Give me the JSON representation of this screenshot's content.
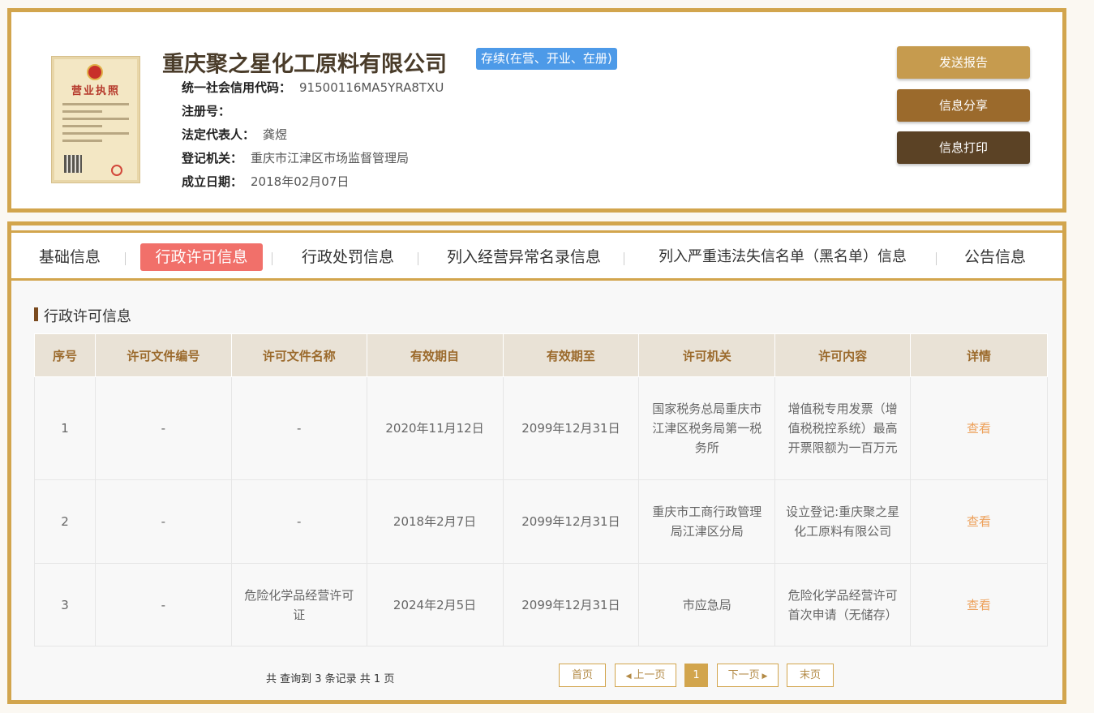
{
  "header": {
    "license_title": "营业执照",
    "company_name": "重庆聚之星化工原料有限公司",
    "status": "存续(在营、开业、在册)",
    "fields": [
      {
        "label": "统一社会信用代码：",
        "value": "91500116MA5YRA8TXU"
      },
      {
        "label": "注册号：",
        "value": ""
      },
      {
        "label": "法定代表人：",
        "value": "龚煜"
      },
      {
        "label": "登记机关：",
        "value": "重庆市江津区市场监督管理局"
      },
      {
        "label": "成立日期：",
        "value": "2018年02月07日"
      }
    ],
    "buttons": {
      "send": "发送报告",
      "share": "信息分享",
      "print": "信息打印"
    }
  },
  "tabs": [
    {
      "label": "基础信息",
      "active": false
    },
    {
      "label": "行政许可信息",
      "active": true
    },
    {
      "label": "行政处罚信息",
      "active": false
    },
    {
      "label": "列入经营异常名录信息",
      "active": false
    },
    {
      "label": "列入严重违法失信名单（黑名单）信息",
      "active": false
    },
    {
      "label": "公告信息",
      "active": false
    }
  ],
  "section": {
    "title": "行政许可信息"
  },
  "table": {
    "headers": [
      "序号",
      "许可文件编号",
      "许可文件名称",
      "有效期自",
      "有效期至",
      "许可机关",
      "许可内容",
      "详情"
    ],
    "rows": [
      [
        "1",
        "-",
        "-",
        "2020年11月12日",
        "2099年12月31日",
        "国家税务总局重庆市江津区税务局第一税务所",
        "增值税专用发票（增值税税控系统）最高开票限额为一百万元",
        "查看"
      ],
      [
        "2",
        "-",
        "-",
        "2018年2月7日",
        "2099年12月31日",
        "重庆市工商行政管理局江津区分局",
        "设立登记:重庆聚之星化工原料有限公司",
        "查看"
      ],
      [
        "3",
        "-",
        "危险化学品经营许可证",
        "2024年2月5日",
        "2099年12月31日",
        "市应急局",
        "危险化学品经营许可首次申请（无储存）",
        "查看"
      ]
    ]
  },
  "pager": {
    "summary": "共 查询到 3 条记录 共 1 页",
    "first": "首页",
    "prev": "上一页",
    "current": "1",
    "next": "下一页",
    "last": "末页"
  },
  "colors": {
    "accent": "#d2a54d",
    "active_tab": "#f1706a",
    "status_badge": "#4d9ae8",
    "link": "#eda15c"
  }
}
